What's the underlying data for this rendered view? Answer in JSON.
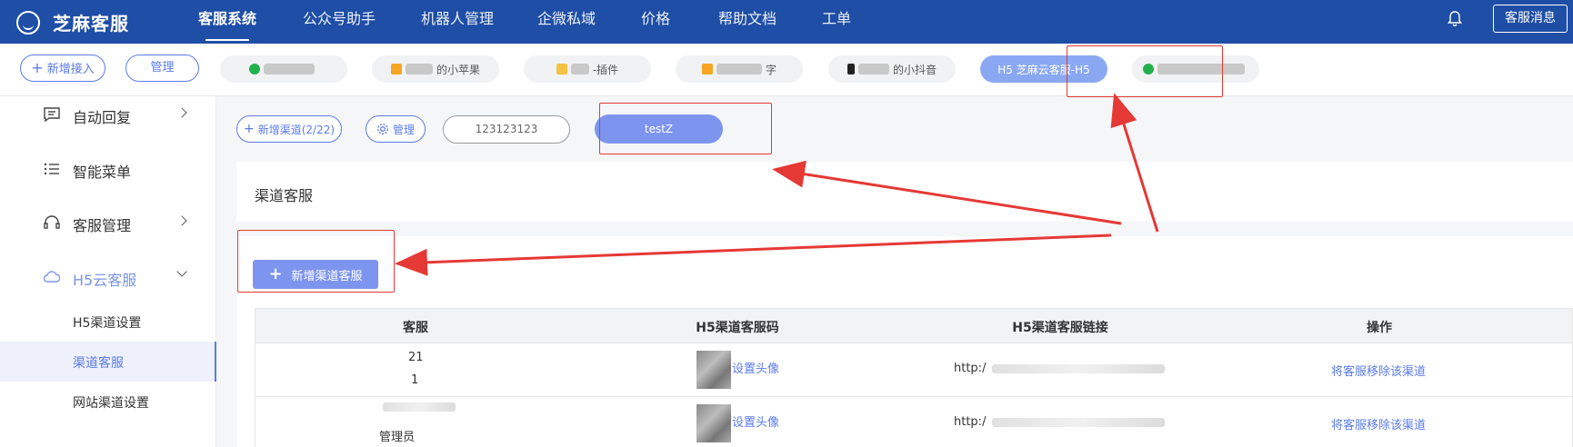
{
  "app": {
    "name": "芝麻客服"
  },
  "nav": [
    {
      "label": "客服系统",
      "active": true
    },
    {
      "label": "公众号助手"
    },
    {
      "label": "机器人管理"
    },
    {
      "label": "企微私域"
    },
    {
      "label": "价格"
    },
    {
      "label": "帮助文档"
    },
    {
      "label": "工单"
    }
  ],
  "topbar": {
    "message_button": "客服消息"
  },
  "channel_strip": {
    "add_label": "新增接入",
    "manage_label": "管理",
    "channels": [
      {
        "label": "",
        "icon": "wechat-icon"
      },
      {
        "label": "的小苹果",
        "icon": "mini-program-icon"
      },
      {
        "label": "-插件",
        "icon": "plugin-icon"
      },
      {
        "label": "字",
        "icon": "mini-program-icon"
      },
      {
        "label": "的小抖音",
        "icon": "tiktok-icon"
      },
      {
        "label": "H5 芝麻云客服-H5",
        "icon": "h5-icon",
        "active": true
      },
      {
        "label": "",
        "icon": "wechat-icon"
      }
    ]
  },
  "sidebar": {
    "items": [
      {
        "label": "自动回复",
        "icon": "message-icon"
      },
      {
        "label": "智能菜单",
        "icon": "list-icon"
      },
      {
        "label": "客服管理",
        "icon": "headset-icon"
      },
      {
        "label": "H5云客服",
        "icon": "cloud-icon",
        "expanded": true
      }
    ],
    "sub_items": [
      {
        "label": "H5渠道设置"
      },
      {
        "label": "渠道客服",
        "active": true
      },
      {
        "label": "网站渠道设置"
      }
    ]
  },
  "subchannels": {
    "add_label": "新增渠道(2/22)",
    "manage_label": "管理",
    "items": [
      "123123123",
      "testZ"
    ]
  },
  "section": {
    "title": "渠道客服"
  },
  "add_agent_button": "新增渠道客服",
  "table": {
    "columns": [
      "客服",
      "H5渠道客服码",
      "H5渠道客服链接",
      "操作"
    ],
    "rows": [
      {
        "agent_line1": "21",
        "agent_line2": "1",
        "avatar_action": "设置头像",
        "link": "http:/",
        "op": "将客服移除该渠道"
      },
      {
        "agent_line1": "",
        "agent_line2": "管理员",
        "avatar_action": "设置头像",
        "link": "http:/",
        "op": "将客服移除该渠道"
      }
    ]
  },
  "colors": {
    "brand": "#1e4ea6",
    "accent": "#5b7be8",
    "annotation": "#e53935"
  }
}
